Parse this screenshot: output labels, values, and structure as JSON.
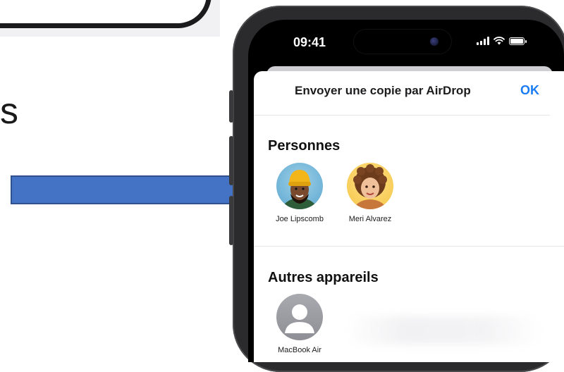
{
  "background_fragment": {
    "cut_text": "s"
  },
  "status_bar": {
    "time": "09:41"
  },
  "sheet": {
    "title": "Envoyer une copie par AirDrop",
    "ok_label": "OK"
  },
  "people_section": {
    "title": "Personnes",
    "contacts": [
      {
        "name": "Joe Lipscomb",
        "avatar": "memoji-yellow-beanie"
      },
      {
        "name": "Meri Alvarez",
        "avatar": "memoji-curly-hair"
      }
    ]
  },
  "devices_section": {
    "title": "Autres appareils",
    "devices": [
      {
        "name": "MacBook Air",
        "avatar": "generic-person-icon"
      }
    ]
  },
  "colors": {
    "accent": "#1a7cf6",
    "arrow_fill": "#4472c4",
    "arrow_stroke": "#2f528f"
  }
}
